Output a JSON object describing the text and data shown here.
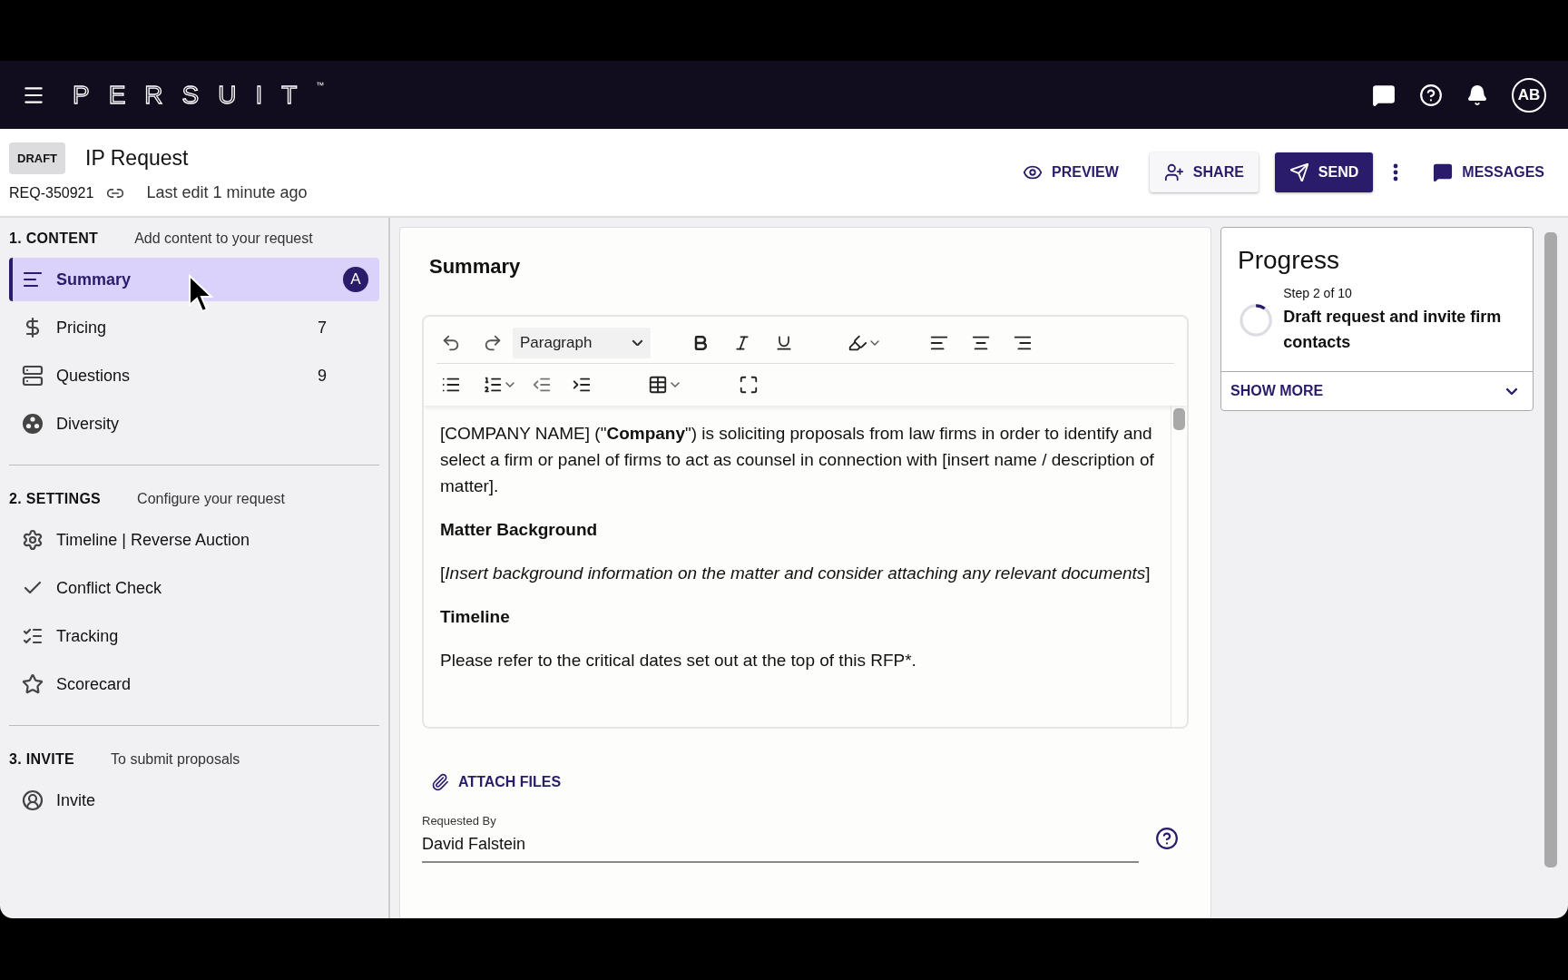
{
  "topbar": {
    "logo": "PERSUIT",
    "logo_mark": "™",
    "avatar": "AB"
  },
  "header": {
    "status": "DRAFT",
    "title": "IP Request",
    "request_id": "REQ-350921",
    "last_edit": "Last edit 1 minute ago",
    "actions": [
      {
        "kind": "preview",
        "label": "PREVIEW"
      },
      {
        "kind": "share",
        "label": "SHARE"
      },
      {
        "kind": "send",
        "label": "SEND"
      },
      {
        "kind": "more"
      },
      {
        "kind": "messages",
        "label": "MESSAGES"
      }
    ]
  },
  "sidebar": {
    "sections": [
      {
        "title": "1. CONTENT",
        "subtitle": "Add content to your request",
        "items": [
          {
            "kind": "lines",
            "label": "Summary",
            "badge": "A",
            "selected": true
          },
          {
            "kind": "dollar",
            "label": "Pricing",
            "count": "7",
            "selected": false
          },
          {
            "kind": "storage",
            "label": "Questions",
            "count": "9",
            "selected": false
          },
          {
            "kind": "palette",
            "label": "Diversity",
            "selected": false
          }
        ]
      },
      {
        "title": "2. SETTINGS",
        "subtitle": "Configure your request",
        "items": [
          {
            "kind": "gear",
            "label": "Timeline | Reverse Auction",
            "selected": false
          },
          {
            "kind": "check",
            "label": "Conflict Check",
            "selected": false
          },
          {
            "kind": "checklist",
            "label": "Tracking",
            "selected": false
          },
          {
            "kind": "star",
            "label": "Scorecard",
            "selected": false
          }
        ]
      },
      {
        "title": "3. INVITE",
        "subtitle": "To submit proposals",
        "items": [
          {
            "kind": "person",
            "label": "Invite",
            "selected": false
          }
        ]
      }
    ]
  },
  "editor": {
    "title": "Summary",
    "block_format": "Paragraph",
    "content": [
      {
        "kind": "paragraph",
        "text": "[COMPANY NAME] (\"**Company**\") is soliciting proposals from law firms in order to identify and select a firm or panel of firms to act as counsel in connection with [insert name / description of matter]."
      },
      {
        "kind": "heading",
        "text": "Matter Background"
      },
      {
        "kind": "paragraph",
        "text": "[*Insert background information on the matter and consider attaching any relevant documents*]"
      },
      {
        "kind": "heading",
        "text": "Timeline"
      },
      {
        "kind": "paragraph",
        "text": "Please refer to the critical dates set out at the top of this RFP*."
      }
    ],
    "attach": "ATTACH FILES",
    "field": {
      "label": "Requested By",
      "value": "David Falstein"
    }
  },
  "progress": {
    "title": "Progress",
    "step": "Step 2 of 10",
    "description": "Draft request and invite firm contacts",
    "level": 0.1,
    "toggle": "SHOW MORE"
  }
}
